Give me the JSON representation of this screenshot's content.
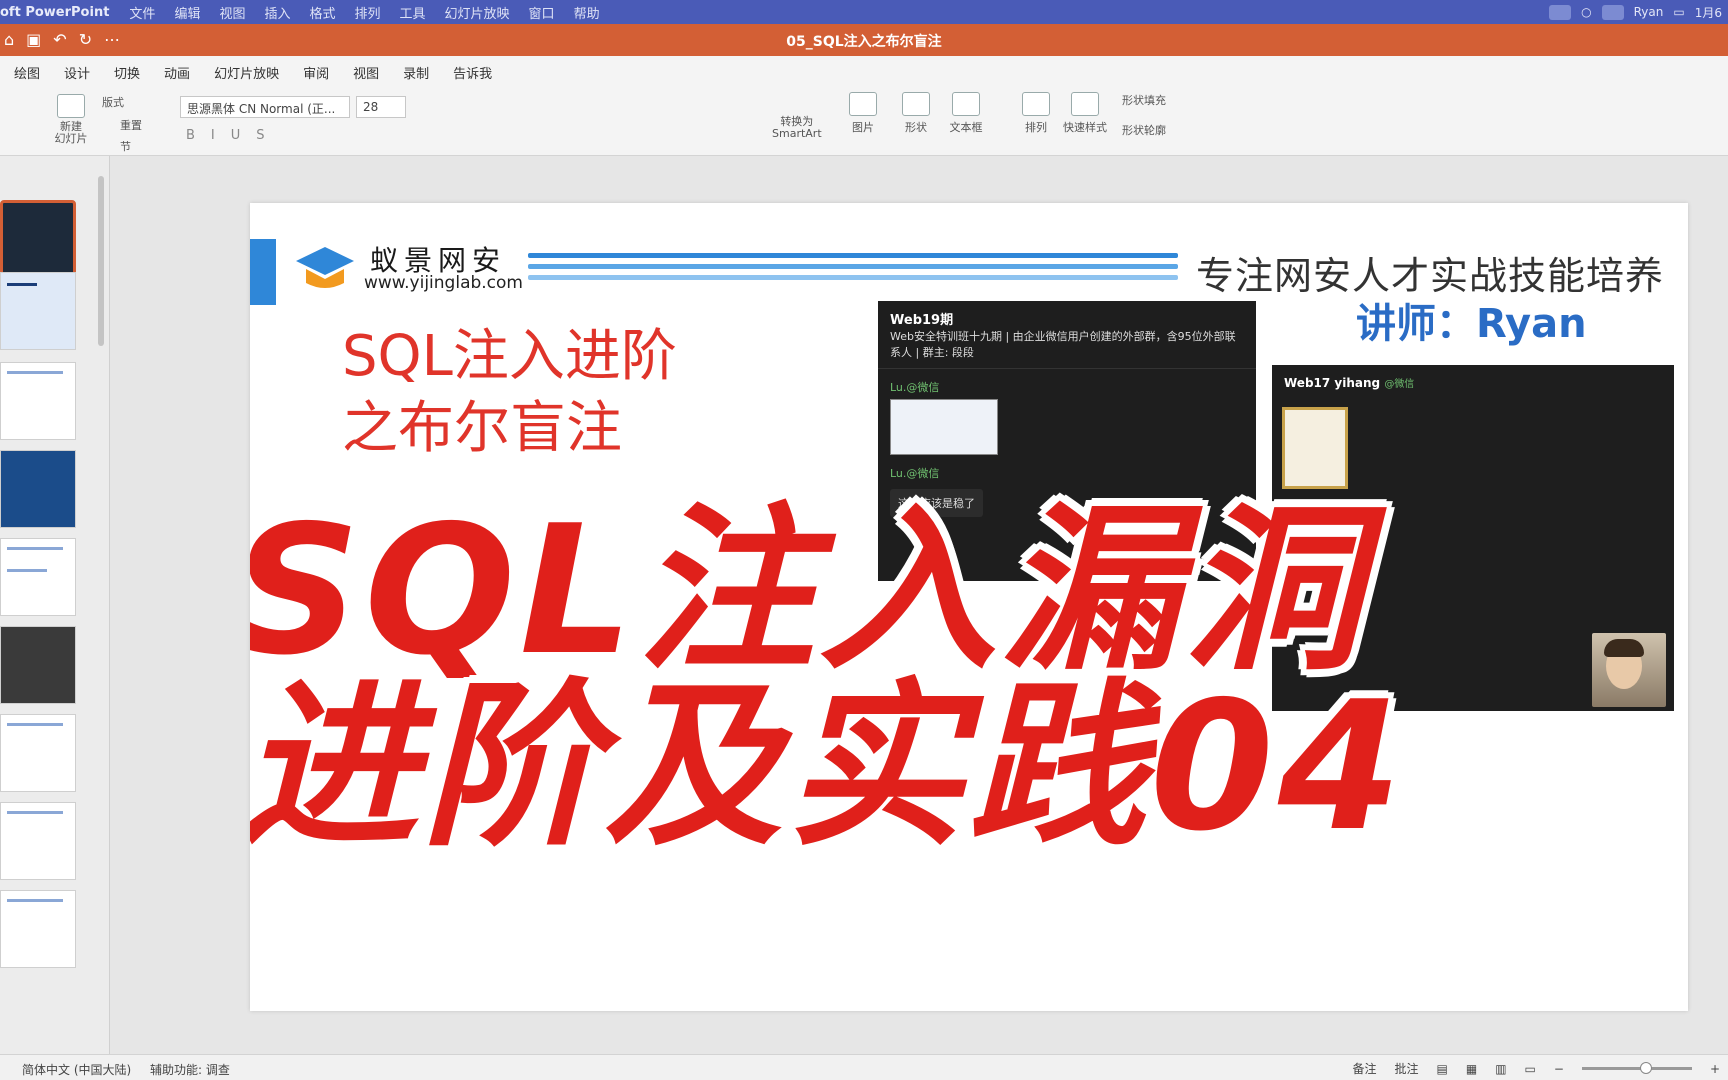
{
  "menubar": {
    "app": "oft PowerPoint",
    "items": [
      "文件",
      "编辑",
      "视图",
      "插入",
      "格式",
      "排列",
      "工具",
      "幻灯片放映",
      "窗口",
      "帮助"
    ],
    "user": "Ryan",
    "date": "1月6"
  },
  "titlebar": {
    "document": "05_SQL注入之布尔盲注"
  },
  "ribbon_tabs": [
    "绘图",
    "设计",
    "切换",
    "动画",
    "幻灯片放映",
    "审阅",
    "视图",
    "录制",
    "告诉我"
  ],
  "ribbon": {
    "new_slide": "新建\n幻灯片",
    "layout": "版式",
    "reset": "重置",
    "section": "节",
    "font": "思源黑体 CN Normal (正...",
    "font_size": "28",
    "smartart": "转换为\nSmartArt",
    "picture": "图片",
    "shape": "形状",
    "textbox": "文本框",
    "arrange": "排列",
    "quick_styles": "快速样式",
    "shape_fill": "形状填充",
    "shape_outline": "形状轮廓"
  },
  "slide": {
    "brand": "蚁景网安",
    "brand_url": "www.yijinglab.com",
    "tagline": "专注网安人才实战技能培养",
    "lecturer": "讲师：Ryan",
    "subtitle_line1": "SQL注入进阶",
    "subtitle_line2": "之布尔盲注",
    "headline_line1": "SQL注入漏洞",
    "headline_line2": "进阶及实践04",
    "chat1": {
      "title": "Web19期",
      "desc": "Web安全特训班十九期 | 由企业微信用户创建的外部群，含95位外部联系人 | 群主: 段段",
      "sender1": "Lu.@微信",
      "sender2": "Lu.@微信",
      "msg": "这个应该是稳了"
    },
    "chat2": {
      "title": "Web17 yihang",
      "tag": "@微信"
    }
  },
  "statusbar": {
    "language": "简体中文 (中国大陆)",
    "accessibility": "辅助功能: 调查",
    "notes": "备注",
    "comments": "批注"
  },
  "colors": {
    "menubar": "#4a5bb7",
    "titlebar": "#d35f35",
    "headline": "#e0201b",
    "lecturer": "#2a6cc5"
  }
}
